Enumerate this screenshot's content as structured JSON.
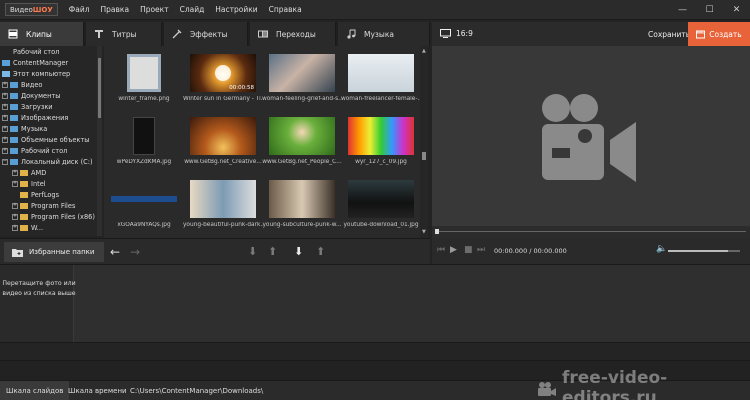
{
  "app": {
    "logo_part1": "Видео",
    "logo_part2": "ШОУ"
  },
  "menu": [
    "Файл",
    "Правка",
    "Проект",
    "Слайд",
    "Настройки",
    "Справка"
  ],
  "window": {
    "minimize": "—",
    "maximize": "☐",
    "close": "✕"
  },
  "tabs": [
    {
      "label": "Клипы",
      "icon": "film-icon",
      "active": true
    },
    {
      "label": "Титры",
      "icon": "text-icon"
    },
    {
      "label": "Эффекты",
      "icon": "effects-icon"
    },
    {
      "label": "Переходы",
      "icon": "transitions-icon"
    },
    {
      "label": "Музыка",
      "icon": "music-icon"
    }
  ],
  "tree": [
    {
      "label": "Рабочий стол",
      "indent": 0
    },
    {
      "label": "ContentManager",
      "indent": 0,
      "icon": "user"
    },
    {
      "label": "Этот компьютер",
      "indent": 0,
      "icon": "computer"
    },
    {
      "label": "Видео",
      "indent": 1,
      "expand": "+"
    },
    {
      "label": "Документы",
      "indent": 1,
      "expand": "+"
    },
    {
      "label": "Загрузки",
      "indent": 1,
      "expand": "+"
    },
    {
      "label": "Изображения",
      "indent": 1,
      "expand": "+"
    },
    {
      "label": "Музыка",
      "indent": 1,
      "expand": "+"
    },
    {
      "label": "Объемные объекты",
      "indent": 1,
      "expand": "+"
    },
    {
      "label": "Рабочий стол",
      "indent": 1,
      "expand": "+"
    },
    {
      "label": "Локальный диск (C:)",
      "indent": 1,
      "expand": "−"
    },
    {
      "label": "AMD",
      "indent": 2,
      "expand": "+"
    },
    {
      "label": "Intel",
      "indent": 2,
      "expand": "+"
    },
    {
      "label": "PerfLogs",
      "indent": 2,
      "expand": ""
    },
    {
      "label": "Program Files",
      "indent": 2,
      "expand": "+"
    },
    {
      "label": "Program Files (x86)",
      "indent": 2,
      "expand": "+"
    },
    {
      "label": "W...",
      "indent": 2,
      "expand": "+"
    }
  ],
  "files": [
    {
      "name": "winter_frame.png",
      "style": "frame"
    },
    {
      "name": "Winter sun in Germany - Ti...",
      "style": "video"
    },
    {
      "name": "woman-feeling-grief-and-s...",
      "style": "grief"
    },
    {
      "name": "woman-freelancer-female-...",
      "style": "freelancer"
    },
    {
      "name": "wPeDYXZdKMA.jpg",
      "style": "phone"
    },
    {
      "name": "www.GetBg.net_Creative...",
      "style": "trees"
    },
    {
      "name": "www.GetBg.net_People_C...",
      "style": "child"
    },
    {
      "name": "wyr_127_c_09.jpg",
      "style": "colorful"
    },
    {
      "name": "xGOAa9NYAQs.jpg",
      "style": "blue"
    },
    {
      "name": "young-beautiful-punk-dark...",
      "style": "punk"
    },
    {
      "name": "young-subculture-punk-w...",
      "style": "punk2"
    },
    {
      "name": "youtube-download_01.jpg",
      "style": "screen"
    }
  ],
  "favbar": {
    "label": "Избранные папки"
  },
  "preview": {
    "ratio": "16:9",
    "save": "Сохранить",
    "create": "Создать",
    "time": "00:00.000 / 00:00.000"
  },
  "slides": {
    "placeholder": "Перетащите фото или видео из списка выше"
  },
  "status": {
    "tab1": "Шкала слайдов",
    "tab2": "Шкала времени",
    "path": "C:\\Users\\ContentManager\\Downloads\\"
  },
  "watermark": "free-video-editors.ru",
  "colors": {
    "accent": "#e8633a",
    "background": "#232323"
  }
}
